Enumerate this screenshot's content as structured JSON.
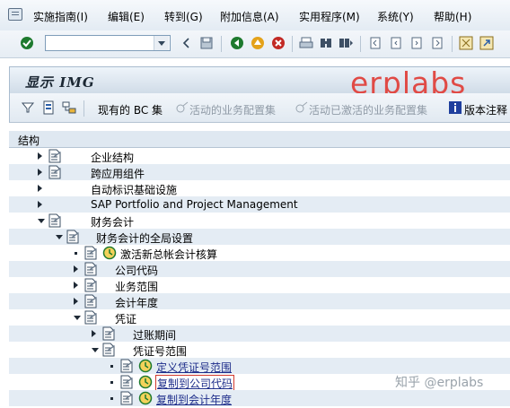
{
  "menu": {
    "items": [
      "实施指南(I)",
      "编辑(E)",
      "转到(G)",
      "附加信息(A)",
      "实用程序(M)",
      "系统(Y)",
      "帮助(H)"
    ]
  },
  "toolbar": {
    "command_field_value": "",
    "icons": [
      "enter-check-icon",
      "save-icon",
      "back-icon",
      "exit-icon",
      "cancel-icon",
      "print-icon",
      "find-icon",
      "find-next-icon",
      "first-page-icon",
      "prev-page-icon",
      "next-page-icon",
      "last-page-icon",
      "new-session-icon",
      "shortcut-icon"
    ]
  },
  "title": {
    "text": "显示 IMG",
    "watermark": "erplabs"
  },
  "app_toolbar": {
    "bc_sets": "现有的 BC 集",
    "activate_bc": "活动的业务配置集",
    "activated_bc": "活动已激活的业务配置集",
    "release_notes": "版本注释"
  },
  "tree": {
    "header": "结构",
    "rows": [
      {
        "label": "企业结构",
        "expander": "closed",
        "icon": "doc",
        "level": 0
      },
      {
        "label": "跨应用组件",
        "expander": "closed",
        "icon": "doc",
        "level": 0
      },
      {
        "label": "自动标识基础设施",
        "expander": "closed",
        "icon": "none",
        "level": 0
      },
      {
        "label": "SAP Portfolio and Project Management",
        "expander": "closed",
        "icon": "none",
        "level": 0
      },
      {
        "label": "财务会计",
        "expander": "open",
        "icon": "doc",
        "level": 0
      },
      {
        "label": "财务会计的全局设置",
        "expander": "open",
        "icon": "doc",
        "level": 1
      },
      {
        "label": "激活新总帐会计核算",
        "expander": "dot",
        "icon": "doc+clock",
        "level": 2
      },
      {
        "label": "公司代码",
        "expander": "closed",
        "icon": "doc",
        "level": 2
      },
      {
        "label": "业务范围",
        "expander": "closed",
        "icon": "doc",
        "level": 2
      },
      {
        "label": "会计年度",
        "expander": "closed",
        "icon": "doc",
        "level": 2
      },
      {
        "label": "凭证",
        "expander": "open",
        "icon": "doc",
        "level": 2
      },
      {
        "label": "过账期间",
        "expander": "closed",
        "icon": "doc",
        "level": 3
      },
      {
        "label": "凭证号范围",
        "expander": "open",
        "icon": "doc",
        "level": 3
      },
      {
        "label": "定义凭证号范围",
        "expander": "dot",
        "icon": "doc+clock",
        "level": 4
      },
      {
        "label": "复制到公司代码",
        "expander": "dot",
        "icon": "doc+clock",
        "level": 4
      },
      {
        "label": "复制到会计年度",
        "expander": "dot",
        "icon": "doc+clock",
        "level": 4
      }
    ]
  },
  "footer_watermark": "知乎 @erplabs",
  "colors": {
    "accent_red": "#e04a45",
    "link_blue": "#1d2d8a",
    "shade": "#e4ecf4"
  }
}
